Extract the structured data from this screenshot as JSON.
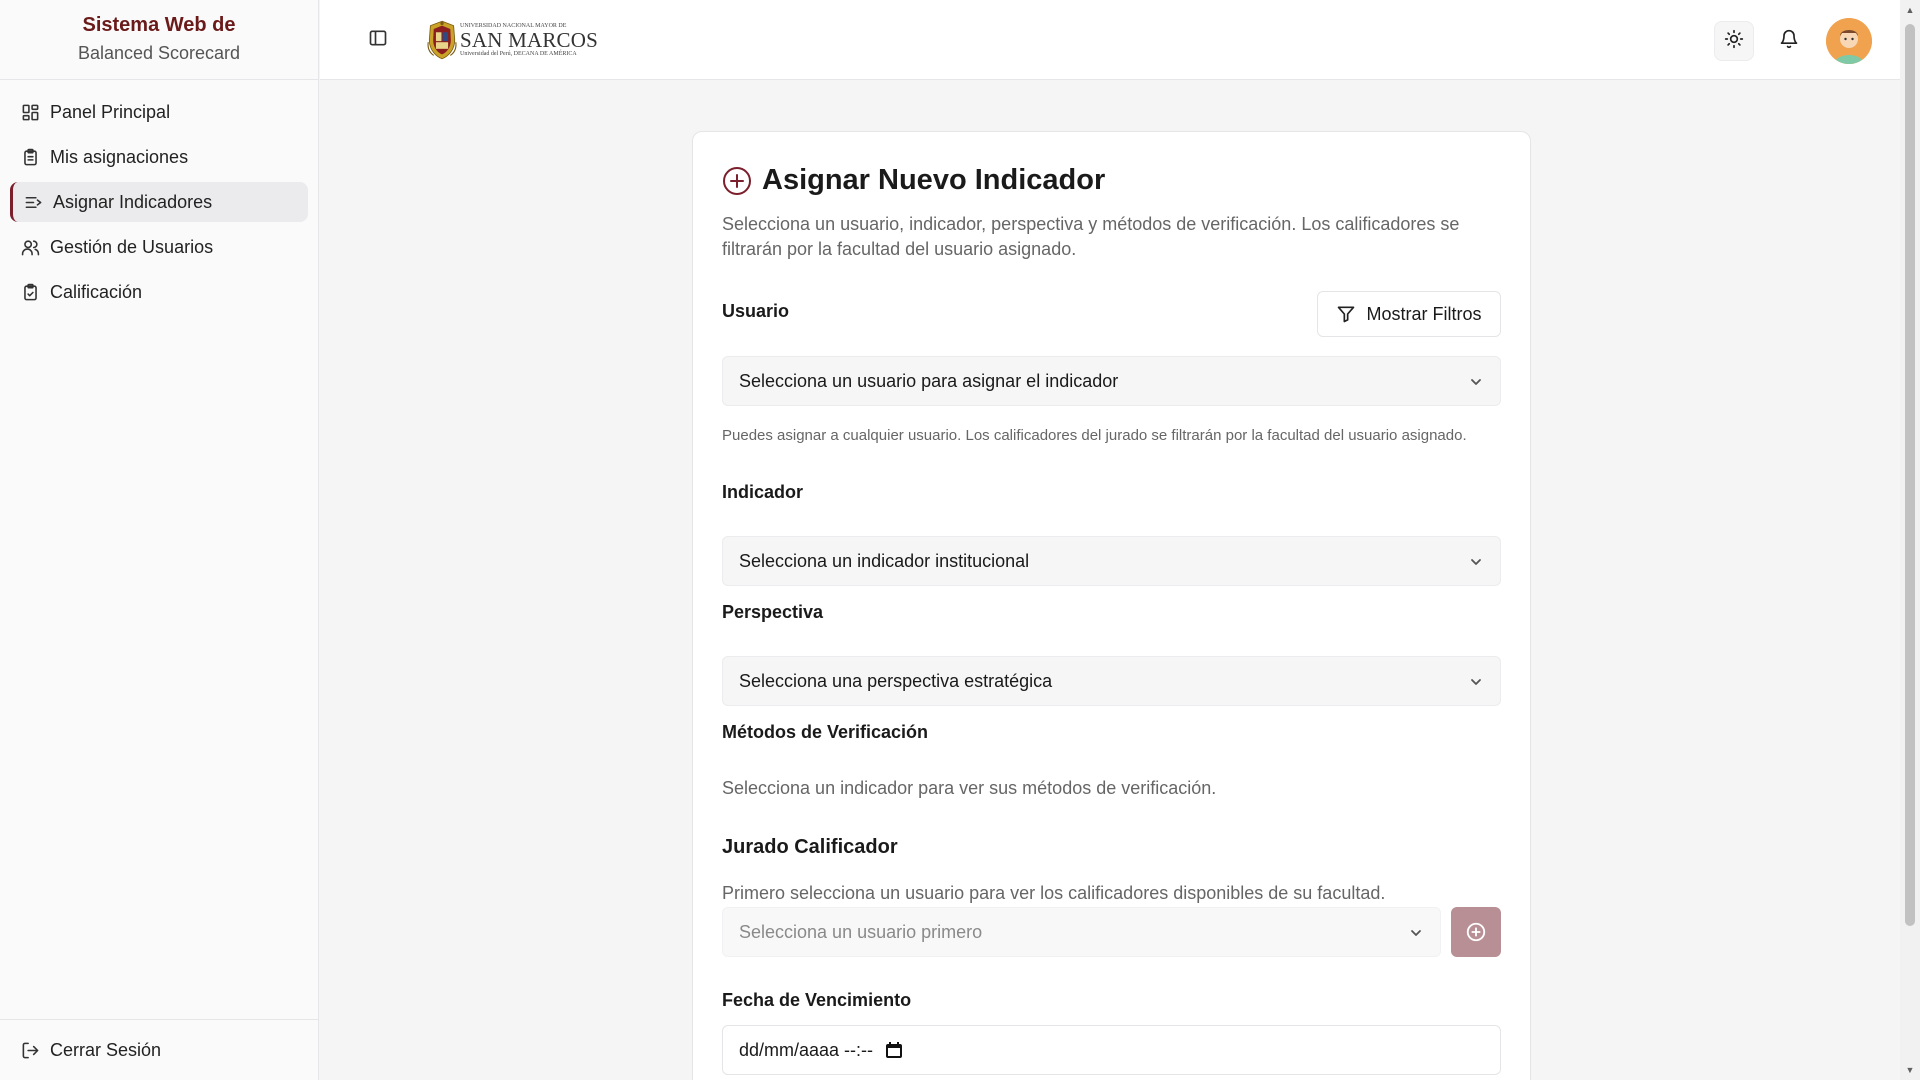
{
  "brand": {
    "title": "Sistema Web de",
    "subtitle": "Balanced Scorecard"
  },
  "sidebar": {
    "items": [
      {
        "label": "Panel Principal",
        "icon": "dashboard-icon",
        "active": false
      },
      {
        "label": "Mis asignaciones",
        "icon": "clipboard-list-icon",
        "active": false
      },
      {
        "label": "Asignar Indicadores",
        "icon": "list-indent-icon",
        "active": true
      },
      {
        "label": "Gestión de Usuarios",
        "icon": "users-icon",
        "active": false
      },
      {
        "label": "Calificación",
        "icon": "clipboard-check-icon",
        "active": false
      }
    ],
    "logout_label": "Cerrar Sesión"
  },
  "topbar": {
    "logo": {
      "small_text": "UNIVERSIDAD NACIONAL MAYOR DE",
      "big_text": "SAN MARCOS",
      "tagline": "Universidad del Perú, DECANA DE AMÉRICA"
    },
    "icons": [
      "sidebar-toggle-icon",
      "sun-icon",
      "bell-icon",
      "avatar"
    ]
  },
  "form": {
    "title": "Asignar Nuevo Indicador",
    "description": "Selecciona un usuario, indicador, perspectiva y métodos de verificación. Los calificadores se filtrarán por la facultad del usuario asignado.",
    "usuario": {
      "label": "Usuario",
      "filter_button": "Mostrar Filtros",
      "placeholder": "Selecciona un usuario para asignar el indicador",
      "hint": "Puedes asignar a cualquier usuario. Los calificadores del jurado se filtrarán por la facultad del usuario asignado."
    },
    "indicador": {
      "label": "Indicador",
      "placeholder": "Selecciona un indicador institucional"
    },
    "perspectiva": {
      "label": "Perspectiva",
      "placeholder": "Selecciona una perspectiva estratégica"
    },
    "metodos": {
      "label": "Métodos de Verificación",
      "message": "Selecciona un indicador para ver sus métodos de verificación."
    },
    "jurado": {
      "label": "Jurado Calificador",
      "message": "Primero selecciona un usuario para ver los calificadores disponibles de su facultad.",
      "placeholder": "Selecciona un usuario primero"
    },
    "fecha": {
      "label": "Fecha de Vencimiento",
      "value": "dd/mm/aaaa --:--"
    }
  },
  "colors": {
    "brand": "#6b1a1a",
    "accent": "#7a1f2b",
    "add_button": "#b88f94"
  }
}
